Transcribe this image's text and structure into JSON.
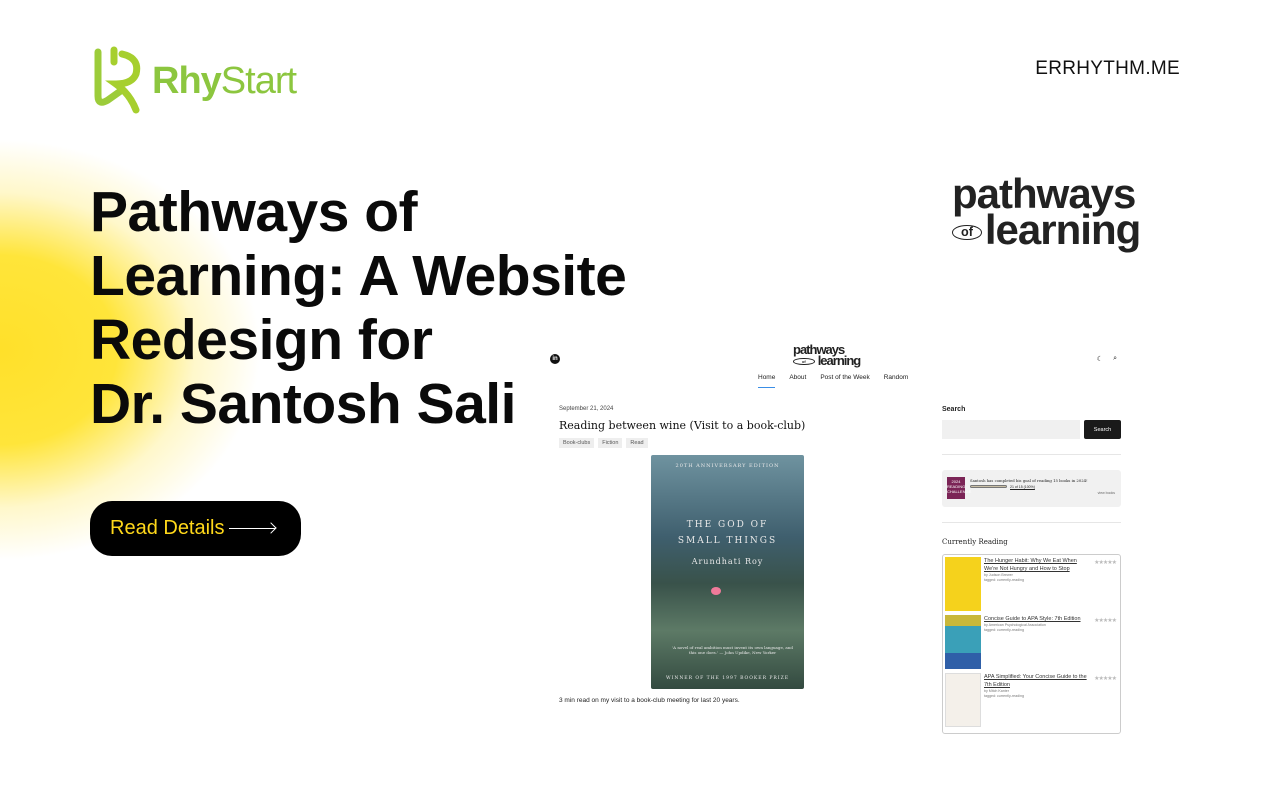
{
  "brand": {
    "name_bold": "Rhy",
    "name_rest": "Start",
    "site": "ERRHYTHM.ME",
    "accent": "#ffe02a",
    "logo_green": "#8cc63f"
  },
  "hero": {
    "title_lines": [
      "Pathways of",
      "Learning: A Website",
      "Redesign for",
      "Dr. Santosh Sali"
    ],
    "button": "Read Details"
  },
  "pathways_logo": {
    "line1": "pathways",
    "of": "of",
    "line2": "learning"
  },
  "website": {
    "nav": [
      "Home",
      "About",
      "Post of the Week",
      "Random"
    ],
    "icons": [
      "linkedin-icon",
      "moon-icon",
      "search-icon"
    ],
    "post": {
      "date": "September 21, 2024",
      "title": "Reading between wine (Visit to a book-club)",
      "tags": [
        "Book-clubs",
        "Fiction",
        "Read"
      ],
      "cover": {
        "edition": "20TH ANNIVERSARY EDITION",
        "title1": "THE GOD OF",
        "title2": "SMALL THINGS",
        "author": "Arundhati Roy",
        "quote": "'A novel of real ambition must invent its own language, and this one does.' — John Updike, New Yorker",
        "award": "WINNER OF THE 1997 BOOKER PRIZE"
      },
      "excerpt": "3 min read on my visit to a book-club meeting for last 20 years."
    },
    "sidebar": {
      "search_heading": "Search",
      "search_button": "Search",
      "goal": {
        "badge": "2024 READING CHALLENGE",
        "text": "Santosh has completed his goal of reading 15 books in 2024!",
        "progress": "21 of 15 (100%)",
        "progress_fraction": 1.0,
        "link": "view books"
      },
      "currently_heading": "Currently Reading",
      "books": [
        {
          "title": "The Hunger Habit: Why We Eat When We're Not Hungry and How to Stop",
          "by": "by Judson Brewer",
          "tagged": "tagged: currently-reading",
          "cover": "#f5d21c"
        },
        {
          "title": "Concise Guide to APA Style: 7th Edition",
          "by": "by American Psychological Association",
          "tagged": "tagged: currently-reading",
          "cover": "#3aa0b8"
        },
        {
          "title": "APA Simplified: Your Concise Guide to the 7th Edition",
          "by": "by Mitch Kanter",
          "tagged": "tagged: currently-reading",
          "cover": "#f4f0ea"
        }
      ]
    }
  }
}
